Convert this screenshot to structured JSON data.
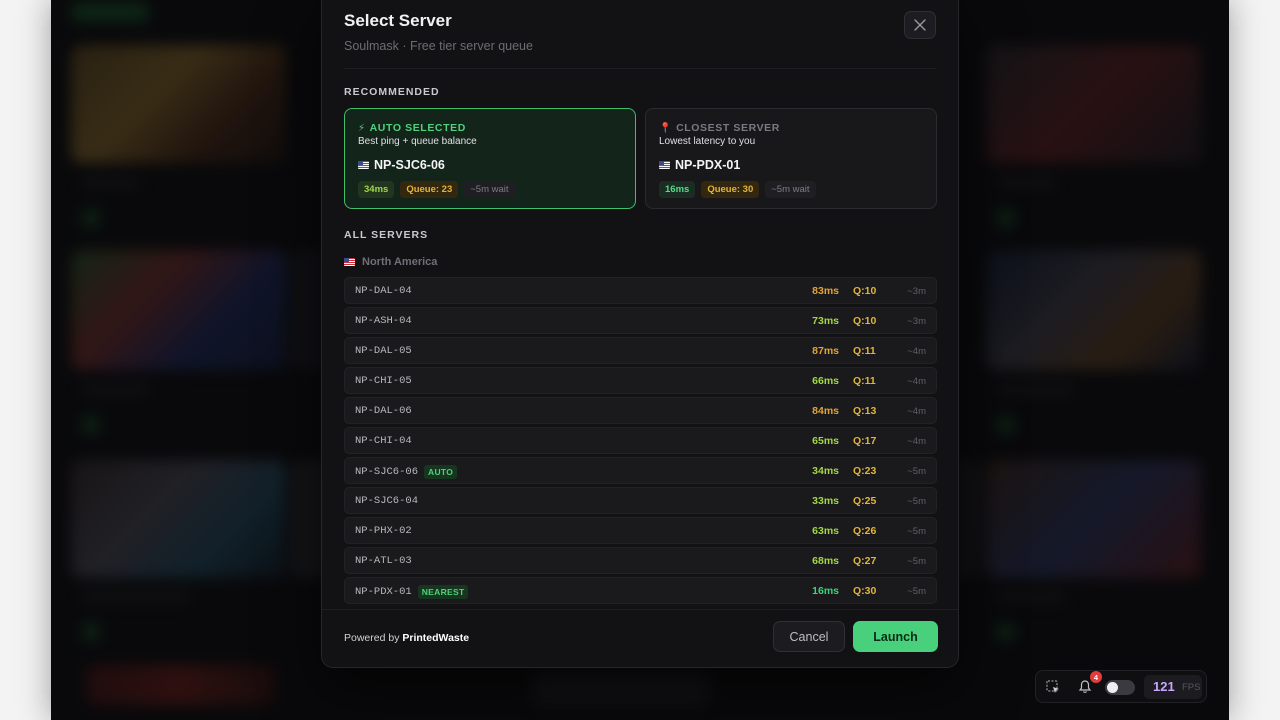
{
  "modal": {
    "title": "Select Server",
    "subtitle": "Soulmask · Free tier server queue",
    "close_icon": "close-icon"
  },
  "recommended": {
    "section_label": "RECOMMENDED",
    "auto": {
      "tag": "AUTO SELECTED",
      "icon": "lightning-icon",
      "description": "Best ping + queue balance",
      "server": "NP-SJC6-06",
      "ping": "34ms",
      "queue": "Queue: 23",
      "wait": "~5m wait"
    },
    "closest": {
      "tag": "CLOSEST SERVER",
      "icon": "pin-icon",
      "description": "Lowest latency to you",
      "server": "NP-PDX-01",
      "ping": "16ms",
      "queue": "Queue: 30",
      "wait": "~5m wait"
    }
  },
  "all_servers": {
    "section_label": "ALL SERVERS",
    "region": "North America",
    "rows": [
      {
        "name": "NP-DAL-04",
        "badge": "",
        "ping": "83ms",
        "ping_color": "orange",
        "queue": "Q:10",
        "wait": "~3m"
      },
      {
        "name": "NP-ASH-04",
        "badge": "",
        "ping": "73ms",
        "ping_color": "lime",
        "queue": "Q:10",
        "wait": "~3m"
      },
      {
        "name": "NP-DAL-05",
        "badge": "",
        "ping": "87ms",
        "ping_color": "orange",
        "queue": "Q:11",
        "wait": "~4m"
      },
      {
        "name": "NP-CHI-05",
        "badge": "",
        "ping": "66ms",
        "ping_color": "lime",
        "queue": "Q:11",
        "wait": "~4m"
      },
      {
        "name": "NP-DAL-06",
        "badge": "",
        "ping": "84ms",
        "ping_color": "orange",
        "queue": "Q:13",
        "wait": "~4m"
      },
      {
        "name": "NP-CHI-04",
        "badge": "",
        "ping": "65ms",
        "ping_color": "lime",
        "queue": "Q:17",
        "wait": "~4m"
      },
      {
        "name": "NP-SJC6-06",
        "badge": "AUTO",
        "ping": "34ms",
        "ping_color": "lime",
        "queue": "Q:23",
        "wait": "~5m"
      },
      {
        "name": "NP-SJC6-04",
        "badge": "",
        "ping": "33ms",
        "ping_color": "lime",
        "queue": "Q:25",
        "wait": "~5m"
      },
      {
        "name": "NP-PHX-02",
        "badge": "",
        "ping": "63ms",
        "ping_color": "lime",
        "queue": "Q:26",
        "wait": "~5m"
      },
      {
        "name": "NP-ATL-03",
        "badge": "",
        "ping": "68ms",
        "ping_color": "lime",
        "queue": "Q:27",
        "wait": "~5m"
      },
      {
        "name": "NP-PDX-01",
        "badge": "NEAREST",
        "ping": "16ms",
        "ping_color": "green",
        "queue": "Q:30",
        "wait": "~5m"
      }
    ]
  },
  "footer": {
    "powered_prefix": "Powered by",
    "powered_brand": "PrintedWaste",
    "cancel_label": "Cancel",
    "launch_label": "Launch"
  },
  "statusbar": {
    "select_icon": "selection-icon",
    "bell_icon": "bell-icon",
    "notification_count": "4",
    "toggle_state": "off",
    "fps_value": "121",
    "fps_label": "FPS"
  },
  "colors": {
    "accent": "#48d07c",
    "selected_border": "#3fbf6a",
    "queue": "#e2b43a",
    "fps": "#c7a6ff"
  }
}
